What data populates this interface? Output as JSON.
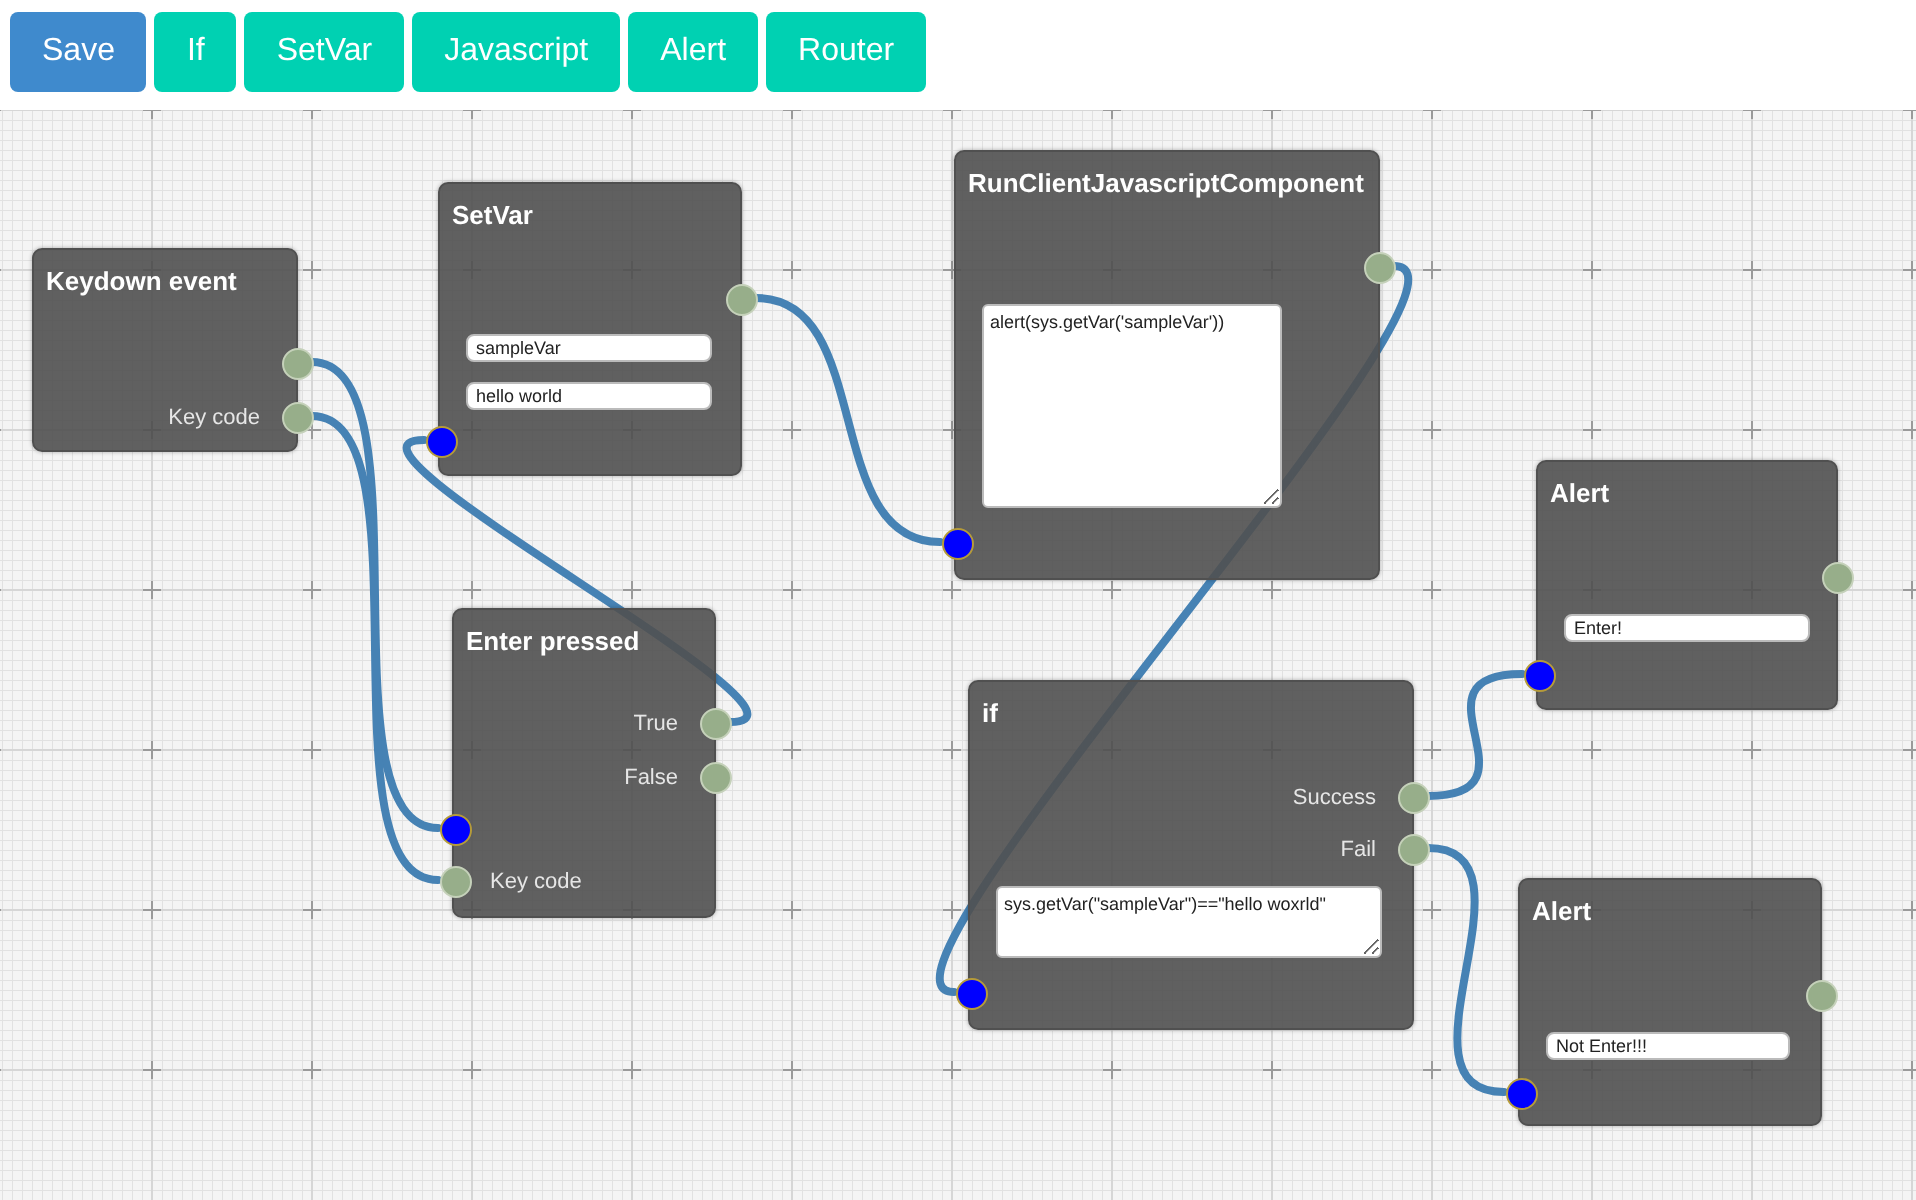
{
  "toolbar": {
    "buttons": [
      {
        "label": "Save",
        "kind": "primary"
      },
      {
        "label": "If",
        "kind": "add"
      },
      {
        "label": "SetVar",
        "kind": "add"
      },
      {
        "label": "Javascript",
        "kind": "add"
      },
      {
        "label": "Alert",
        "kind": "add"
      },
      {
        "label": "Router",
        "kind": "add"
      }
    ]
  },
  "nodes": [
    {
      "title": "Keydown event",
      "items": [
        {
          "kind": "out"
        },
        {
          "kind": "out",
          "label": "Key code"
        }
      ]
    },
    {
      "title": "SetVar",
      "items": [
        {
          "kind": "out"
        },
        {
          "kind": "field",
          "value": "sampleVar"
        },
        {
          "kind": "field",
          "value": "hello world"
        },
        {
          "kind": "in"
        }
      ]
    },
    {
      "title": "Enter pressed",
      "items": [
        {
          "kind": "out",
          "label": "True"
        },
        {
          "kind": "out",
          "label": "False"
        },
        {
          "kind": "in"
        },
        {
          "kind": "param",
          "label": "Key code"
        }
      ]
    },
    {
      "title": "RunClientJavascriptComponent",
      "items": [
        {
          "kind": "out"
        },
        {
          "kind": "textarea",
          "value": "alert(sys.getVar('sampleVar'))"
        },
        {
          "kind": "in"
        }
      ]
    },
    {
      "title": "if",
      "items": [
        {
          "kind": "out",
          "label": "Success"
        },
        {
          "kind": "out",
          "label": "Fail"
        },
        {
          "kind": "textarea",
          "value": "sys.getVar(\"sampleVar\")==\"hello woxrld\""
        },
        {
          "kind": "in"
        }
      ]
    },
    {
      "title": "Alert",
      "items": [
        {
          "kind": "out"
        },
        {
          "kind": "field",
          "value": "Enter!"
        },
        {
          "kind": "in"
        }
      ]
    },
    {
      "title": "Alert",
      "items": [
        {
          "kind": "out"
        },
        {
          "kind": "field",
          "value": "Not Enter!!!"
        },
        {
          "kind": "in"
        }
      ]
    }
  ]
}
